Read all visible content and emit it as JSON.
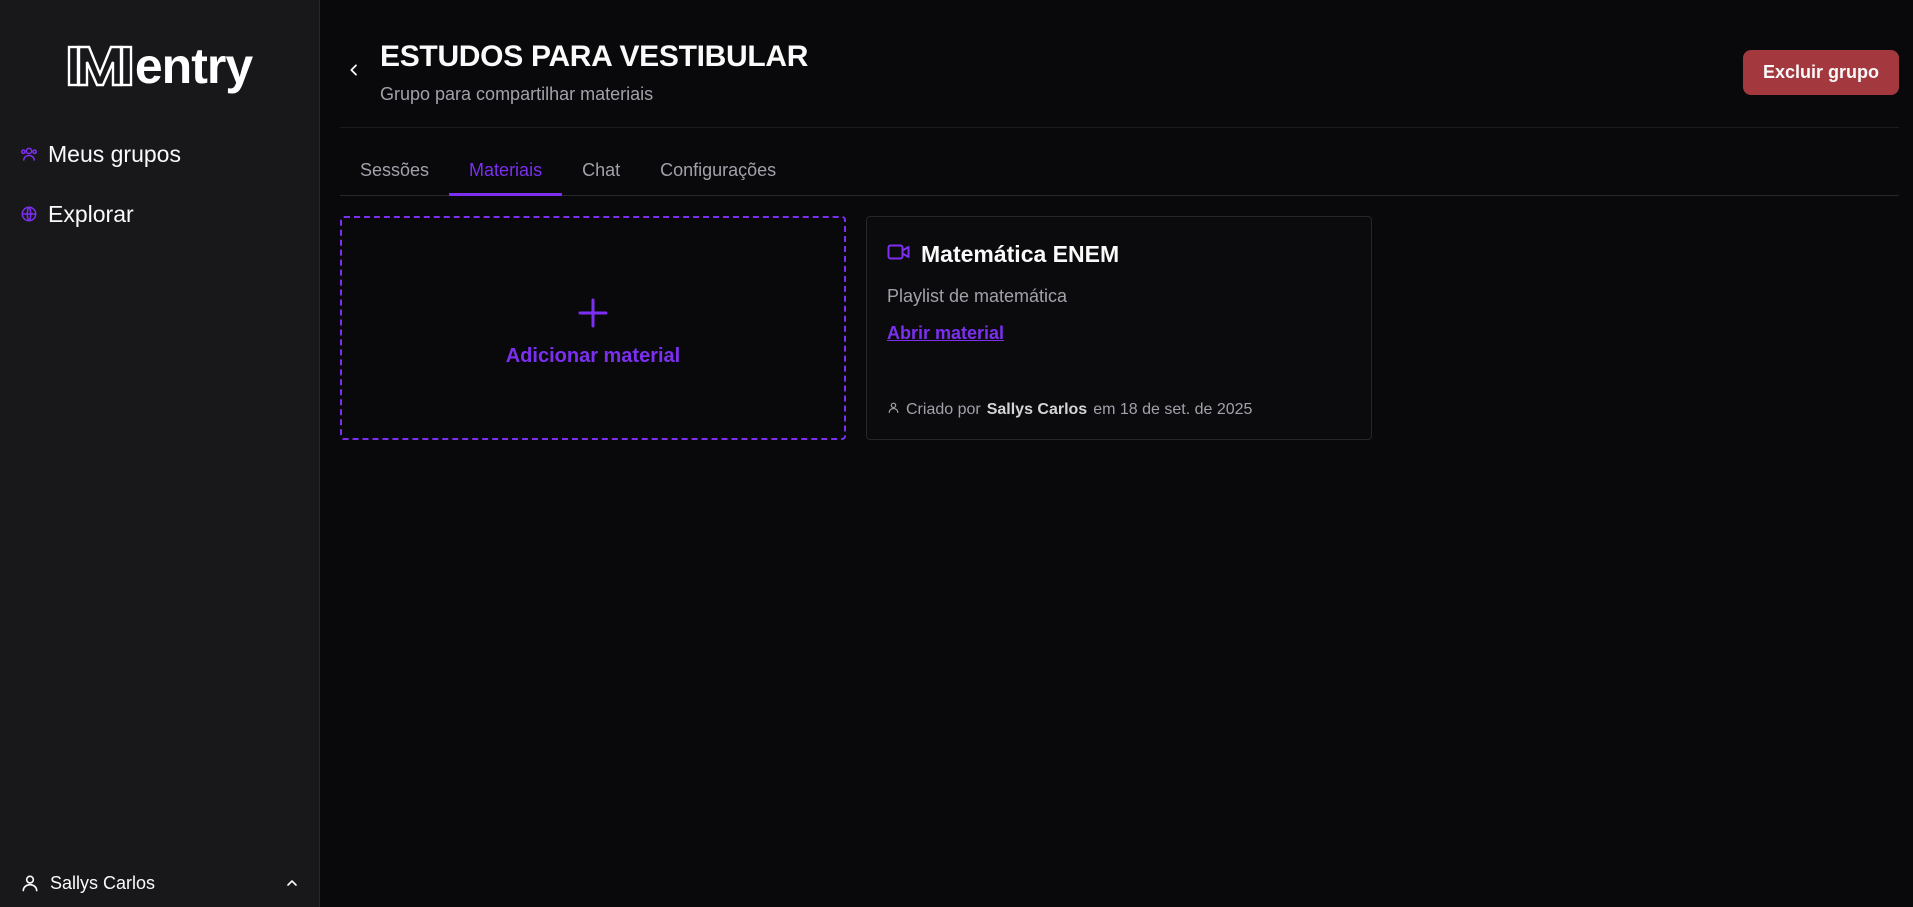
{
  "app": {
    "logo_text": "entry",
    "accent": "#7c2ff0",
    "danger": "#a3393f"
  },
  "sidebar": {
    "items": [
      {
        "label": "Meus grupos",
        "icon": "users-icon"
      },
      {
        "label": "Explorar",
        "icon": "globe-icon"
      }
    ],
    "user": {
      "name": "Sallys Carlos",
      "icon": "user-icon",
      "toggle_icon": "chevron-up-icon"
    }
  },
  "header": {
    "title": "ESTUDOS PARA VESTIBULAR",
    "subtitle": "Grupo para compartilhar materiais",
    "delete_label": "Excluir grupo"
  },
  "tabs": [
    {
      "label": "Sessões",
      "active": false
    },
    {
      "label": "Materiais",
      "active": true
    },
    {
      "label": "Chat",
      "active": false
    },
    {
      "label": "Configurações",
      "active": false
    }
  ],
  "add_card": {
    "label": "Adicionar material",
    "icon": "plus-icon"
  },
  "materials": [
    {
      "icon": "video-icon",
      "title": "Matemática ENEM",
      "description": "Playlist de matemática",
      "link_label": "Abrir material",
      "created_prefix": "Criado por",
      "author": "Sallys Carlos",
      "date_text": "em 18 de set. de 2025"
    }
  ]
}
